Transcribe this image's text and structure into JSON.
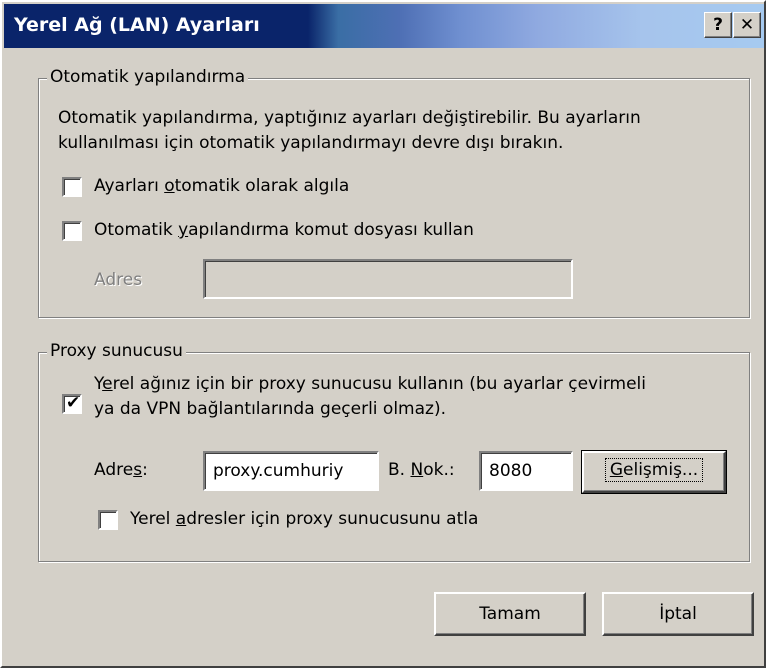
{
  "window": {
    "title": "Yerel Ağ (LAN) Ayarları",
    "help_label": "?",
    "close_label": "✕"
  },
  "auto_config": {
    "group_title": "Otomatik yapılandırma",
    "description_line1": "Otomatik yapılandırma, yaptığınız ayarları değiştirebilir. Bu ayarların",
    "description_line2": "kullanılması için otomatik yapılandırmayı devre dışı bırakın.",
    "detect_label_pre": "Ayarları ",
    "detect_label_accel": "o",
    "detect_label_post": "tomatik olarak algıla",
    "detect_checked": false,
    "script_label_pre": "Otomatik ",
    "script_label_accel": "y",
    "script_label_post": "apılandırma komut dosyası kullan",
    "script_checked": false,
    "address_label": "Adres",
    "address_value": ""
  },
  "proxy": {
    "group_title": "Proxy sunucusu",
    "use_label_line1_pre": "Y",
    "use_label_line1_accel": "e",
    "use_label_line1_post": "rel ağınız için bir proxy sunucusu kullanın (bu ayarlar çevirmeli",
    "use_label_line2": "ya da VPN bağlantılarında geçerli olmaz).",
    "use_checked": true,
    "address_label_pre": "Adre",
    "address_label_accel": "s",
    "address_label_post": ":",
    "address_value": "proxy.cumhuriy",
    "port_label_pre": "B. ",
    "port_label_accel": "N",
    "port_label_post": "ok.:",
    "port_value": "8080",
    "advanced_label_pre": "",
    "advanced_label_accel": "G",
    "advanced_label_post": "elişmiş...",
    "bypass_label_pre": "Yerel ",
    "bypass_label_accel": "a",
    "bypass_label_post": "dresler için proxy sunucusunu atla",
    "bypass_checked": false
  },
  "buttons": {
    "ok_label": "Tamam",
    "cancel_label": "İptal"
  },
  "colors": {
    "titlebar_start": "#0a246a",
    "titlebar_end": "#a6caf0",
    "face": "#d4d0c8"
  }
}
